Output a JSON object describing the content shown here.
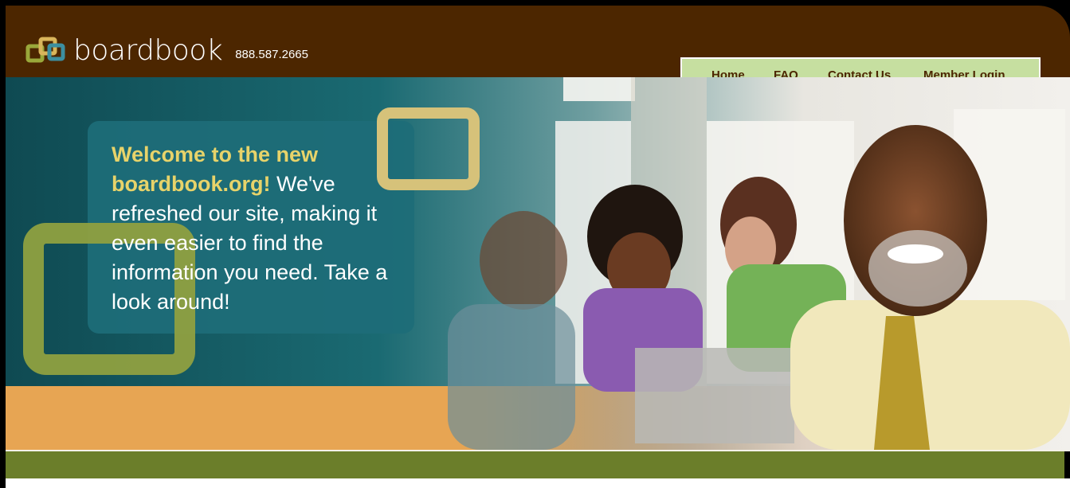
{
  "header": {
    "logo_text": "boardbook",
    "phone": "888.587.2665"
  },
  "nav": {
    "items": [
      {
        "label": "Home"
      },
      {
        "label": "FAQ"
      },
      {
        "label": "Contact Us"
      },
      {
        "label": "Member Login"
      }
    ]
  },
  "hero": {
    "welcome_highlight": "Welcome to the new boardbook.org!",
    "welcome_rest": " We've refreshed our site, making it even easier to find the information you need. Take a look around!"
  },
  "colors": {
    "header_brown": "#4c2600",
    "nav_green": "#c6dfa0",
    "teal": "#1d6a73",
    "olive": "#8fa040",
    "gold": "#d6c27a",
    "orange": "#e6a24e",
    "band_olive": "#6b7e2a"
  }
}
